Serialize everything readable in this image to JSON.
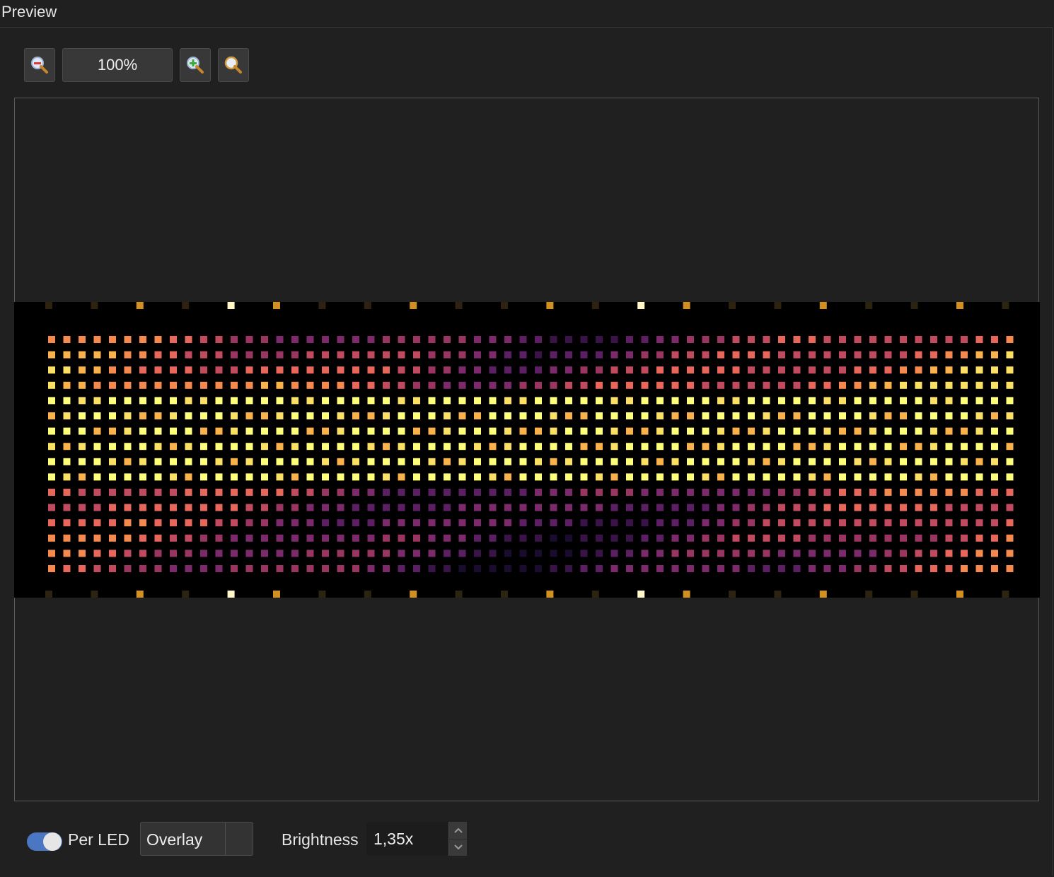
{
  "panel": {
    "title": "Preview"
  },
  "toolbar": {
    "zoom_out_icon": "zoom-out-magnifier",
    "zoom_value": "100%",
    "zoom_in_icon": "zoom-in-magnifier",
    "zoom_fit_icon": "zoom-fit-magnifier"
  },
  "preview": {
    "grid_columns": 64,
    "grid_rows": 16,
    "palette": [
      "#1a0c2e",
      "#3a1449",
      "#5c1f63",
      "#7c2a6c",
      "#9a3461",
      "#c24a5e",
      "#e9665a",
      "#f6894e",
      "#fbb24a",
      "#fce063",
      "#ffff7a"
    ],
    "marker_colors": {
      "bright": "#fff7c8",
      "orange": "#d4901e",
      "dim": "#2c2410"
    }
  },
  "bottom": {
    "per_led_toggle": {
      "label": "Per LED",
      "on": true
    },
    "mode_select": {
      "value": "Overlay"
    },
    "brightness": {
      "label": "Brightness",
      "value": "1,35x"
    }
  }
}
